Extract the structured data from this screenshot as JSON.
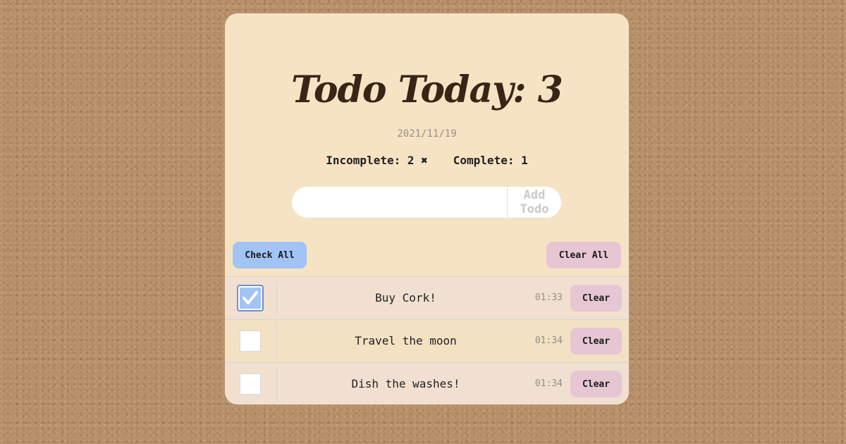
{
  "header": {
    "title": "Todo Today: 3",
    "date": "2021/11/19",
    "incomplete_label": "Incomplete: 2 ✖",
    "complete_label": "Complete: 1"
  },
  "add_form": {
    "input_value": "",
    "placeholder": "",
    "button_label": "Add Todo"
  },
  "controls": {
    "check_all_label": "Check All",
    "clear_all_label": "Clear All"
  },
  "todos": [
    {
      "text": "Buy Cork!",
      "time": "01:33",
      "checked": true,
      "clear_label": "Clear"
    },
    {
      "text": "Travel the moon",
      "time": "01:34",
      "checked": false,
      "clear_label": "Clear"
    },
    {
      "text": "Dish the washes!",
      "time": "01:34",
      "checked": false,
      "clear_label": "Clear"
    }
  ],
  "colors": {
    "background": "#b7906a",
    "card": "#f6e3c3",
    "title": "#3c2318",
    "check_all_button": "#a2c4f5",
    "clear_button": "#e6c6d2"
  }
}
